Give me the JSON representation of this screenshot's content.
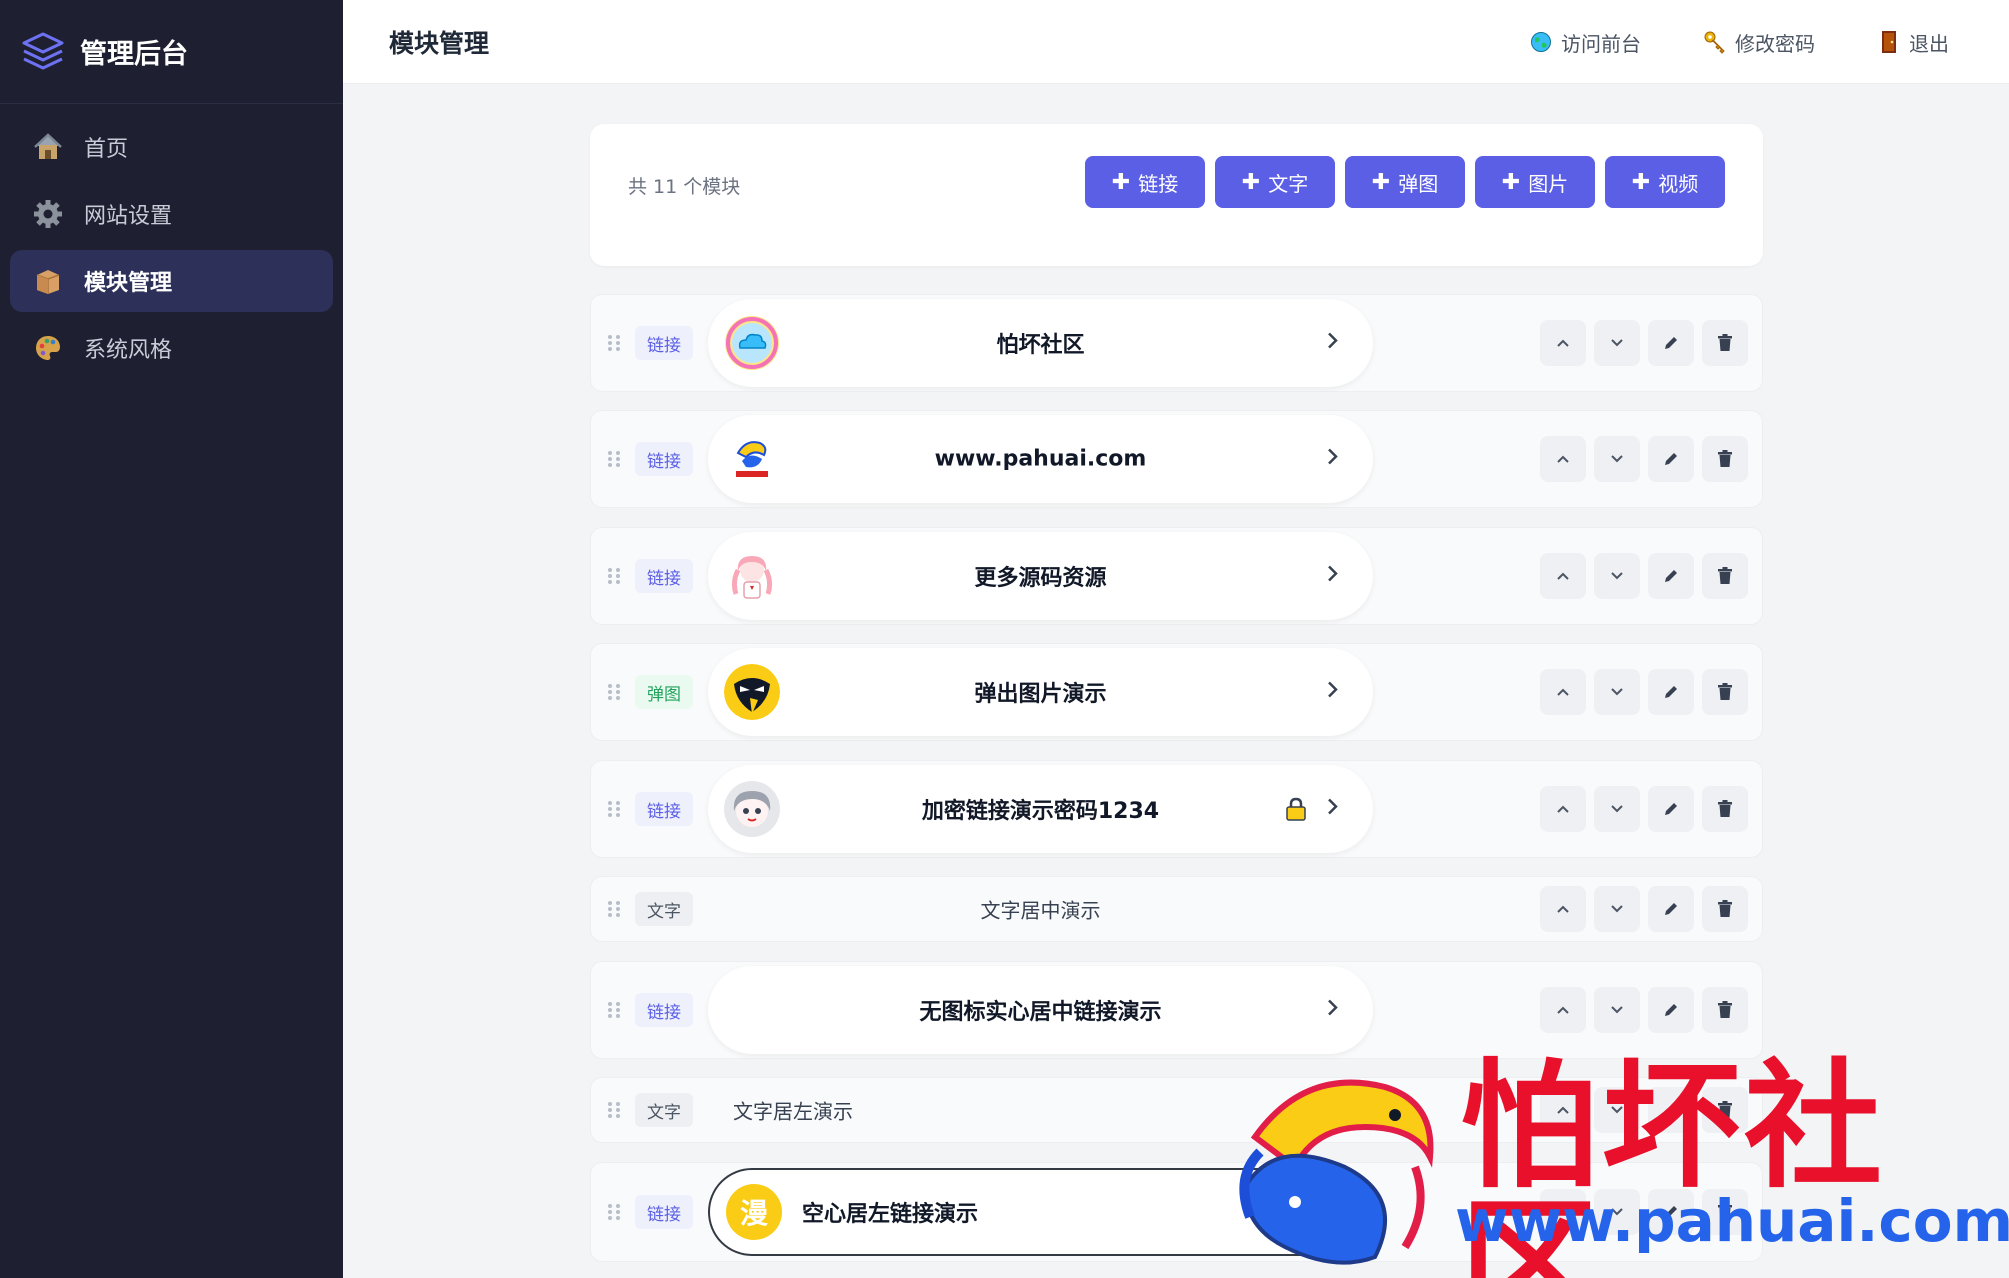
{
  "app": {
    "brand_title": "管理后台",
    "page_title": "模块管理"
  },
  "sidebar": {
    "items": [
      {
        "label": "首页",
        "icon": "house-icon",
        "active": false
      },
      {
        "label": "网站设置",
        "icon": "gear-icon",
        "active": false
      },
      {
        "label": "模块管理",
        "icon": "box-icon",
        "active": true
      },
      {
        "label": "系统风格",
        "icon": "palette-icon",
        "active": false
      }
    ]
  },
  "topbar": {
    "visit_front": "访问前台",
    "change_password": "修改密码",
    "logout": "退出"
  },
  "toolbar": {
    "count_text": "共 11 个模块",
    "plus_glyph": "✚",
    "add_buttons": [
      "链接",
      "文字",
      "弹图",
      "图片",
      "视频"
    ]
  },
  "modules": [
    {
      "tag": "链接",
      "type": "link",
      "label": "怕坏社区",
      "icon": "cloud-icon"
    },
    {
      "tag": "链接",
      "type": "link",
      "label": "www.pahuai.com",
      "icon": "pahuai-logo-icon"
    },
    {
      "tag": "链接",
      "type": "link",
      "label": "更多源码资源",
      "icon": "anime-girl-icon"
    },
    {
      "tag": "弹图",
      "type": "popup",
      "label": "弹出图片演示",
      "icon": "penguin-icon"
    },
    {
      "tag": "链接",
      "type": "link",
      "label": "加密链接演示密码1234",
      "icon": "anime-avatar-icon",
      "locked": true
    },
    {
      "tag": "文字",
      "type": "text",
      "label": "文字居中演示",
      "align": "center"
    },
    {
      "tag": "链接",
      "type": "link",
      "label": "无图标实心居中链接演示"
    },
    {
      "tag": "文字",
      "type": "text",
      "label": "文字居左演示",
      "align": "left"
    },
    {
      "tag": "链接",
      "type": "link",
      "label": "空心居左链接演示",
      "icon": "manga-icon",
      "manga_char": "漫",
      "style": "outline"
    }
  ],
  "watermark": {
    "title": "怕坏社区",
    "url": "www.pahuai.com"
  },
  "colors": {
    "sidebar_bg": "#1e1f30",
    "accent": "#5b5fe6",
    "popup_green": "#22a35c",
    "watermark_red": "#e8102a",
    "watermark_blue": "#2563eb"
  }
}
